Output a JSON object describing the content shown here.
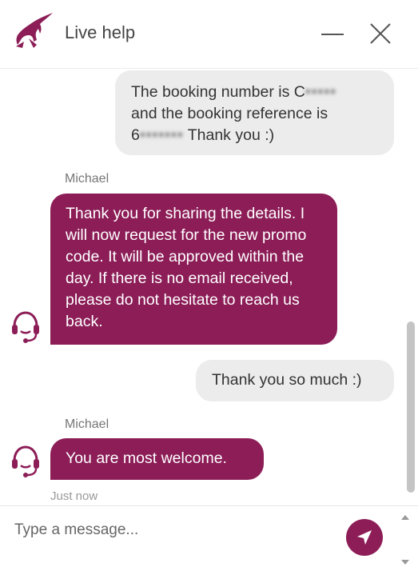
{
  "header": {
    "title": "Live help",
    "logo_icon": "oryx-logo-icon",
    "minimize_icon": "minimize-icon",
    "close_icon": "close-icon"
  },
  "messages": [
    {
      "role": "user",
      "parts": [
        "The booking number is C",
        "and the booking reference is",
        "6",
        "Thank you :)"
      ],
      "redacted": [
        "•••••",
        "•••••••"
      ]
    },
    {
      "role": "agent",
      "sender": "Michael",
      "text": "Thank you for sharing the details. I will now request for the new promo code. It will be approved within the day. If there is no email received, please do not hesitate to reach us back."
    },
    {
      "role": "user",
      "text": "Thank you so much :)"
    },
    {
      "role": "agent",
      "sender": "Michael",
      "text": "You are most welcome.",
      "timestamp": "Just now"
    }
  ],
  "composer": {
    "placeholder": "Type a message...",
    "send_icon": "send-icon"
  },
  "colors": {
    "brand": "#8c1d57",
    "user_bubble": "#ececed"
  },
  "agent_avatar_icon": "headset-agent-icon"
}
